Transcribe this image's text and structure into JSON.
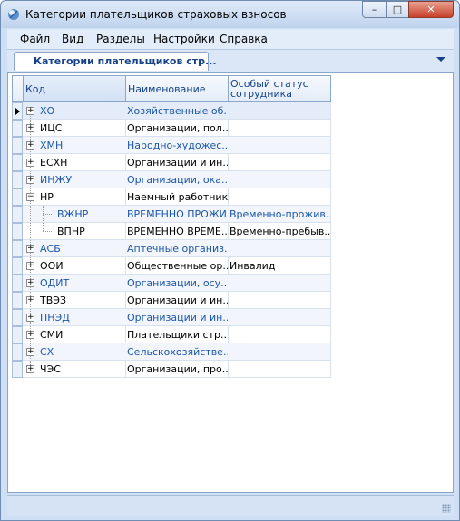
{
  "window": {
    "title": "Категории плательщиков страховых взносов",
    "minimize_glyph": "–",
    "maximize_glyph": "□",
    "close_glyph": "✕"
  },
  "menu": {
    "file": "Файл",
    "view": "Вид",
    "sections": "Разделы",
    "settings": "Настройки",
    "help": "Справка"
  },
  "tab": {
    "label": "Категории плательщиков стр..."
  },
  "grid": {
    "columns": {
      "code": "Код",
      "name": "Наименование",
      "status": "Особый статус сотрудника"
    },
    "rows": [
      {
        "code": "ХО",
        "name": "Хозяйственные об...",
        "status": "",
        "level": 0,
        "expander": "+",
        "blue": true
      },
      {
        "code": "ИЦС",
        "name": "Организации, пол...",
        "status": "",
        "level": 0,
        "expander": "+",
        "blue": false
      },
      {
        "code": "ХМН",
        "name": "Народно-художес...",
        "status": "",
        "level": 0,
        "expander": "+",
        "blue": true
      },
      {
        "code": "ЕСХН",
        "name": "Организации и ин...",
        "status": "",
        "level": 0,
        "expander": "+",
        "blue": false
      },
      {
        "code": "ИНЖУ",
        "name": "Организации, ока...",
        "status": "",
        "level": 0,
        "expander": "+",
        "blue": true
      },
      {
        "code": "НР",
        "name": "Наемный работник",
        "status": "",
        "level": 0,
        "expander": "−",
        "blue": false
      },
      {
        "code": "ВЖНР",
        "name": "ВРЕМЕННО ПРОЖИ...",
        "status": "Временно-прожив...",
        "level": 1,
        "expander": "",
        "blue": true
      },
      {
        "code": "ВПНР",
        "name": "ВРЕМЕННО ВРЕМЕ...",
        "status": "Временно-пребыв...",
        "level": 1,
        "expander": "",
        "blue": false
      },
      {
        "code": "АСБ",
        "name": "Аптечные организ...",
        "status": "",
        "level": 0,
        "expander": "+",
        "blue": true
      },
      {
        "code": "ООИ",
        "name": "Общественные ор...",
        "status": "Инвалид",
        "level": 0,
        "expander": "+",
        "blue": false
      },
      {
        "code": "ОДИТ",
        "name": "Организации, осу...",
        "status": "",
        "level": 0,
        "expander": "+",
        "blue": true
      },
      {
        "code": "ТВЭЗ",
        "name": "Организации и ин...",
        "status": "",
        "level": 0,
        "expander": "+",
        "blue": false
      },
      {
        "code": "ПНЭД",
        "name": "Организации и ин...",
        "status": "",
        "level": 0,
        "expander": "+",
        "blue": true
      },
      {
        "code": "СМИ",
        "name": "Плательщики стр...",
        "status": "",
        "level": 0,
        "expander": "+",
        "blue": false
      },
      {
        "code": "СХ",
        "name": "Сельскохозяйстве...",
        "status": "",
        "level": 0,
        "expander": "+",
        "blue": true
      },
      {
        "code": "ЧЭС",
        "name": "Организации, про...",
        "status": "",
        "level": 0,
        "expander": "+",
        "blue": false
      }
    ]
  }
}
